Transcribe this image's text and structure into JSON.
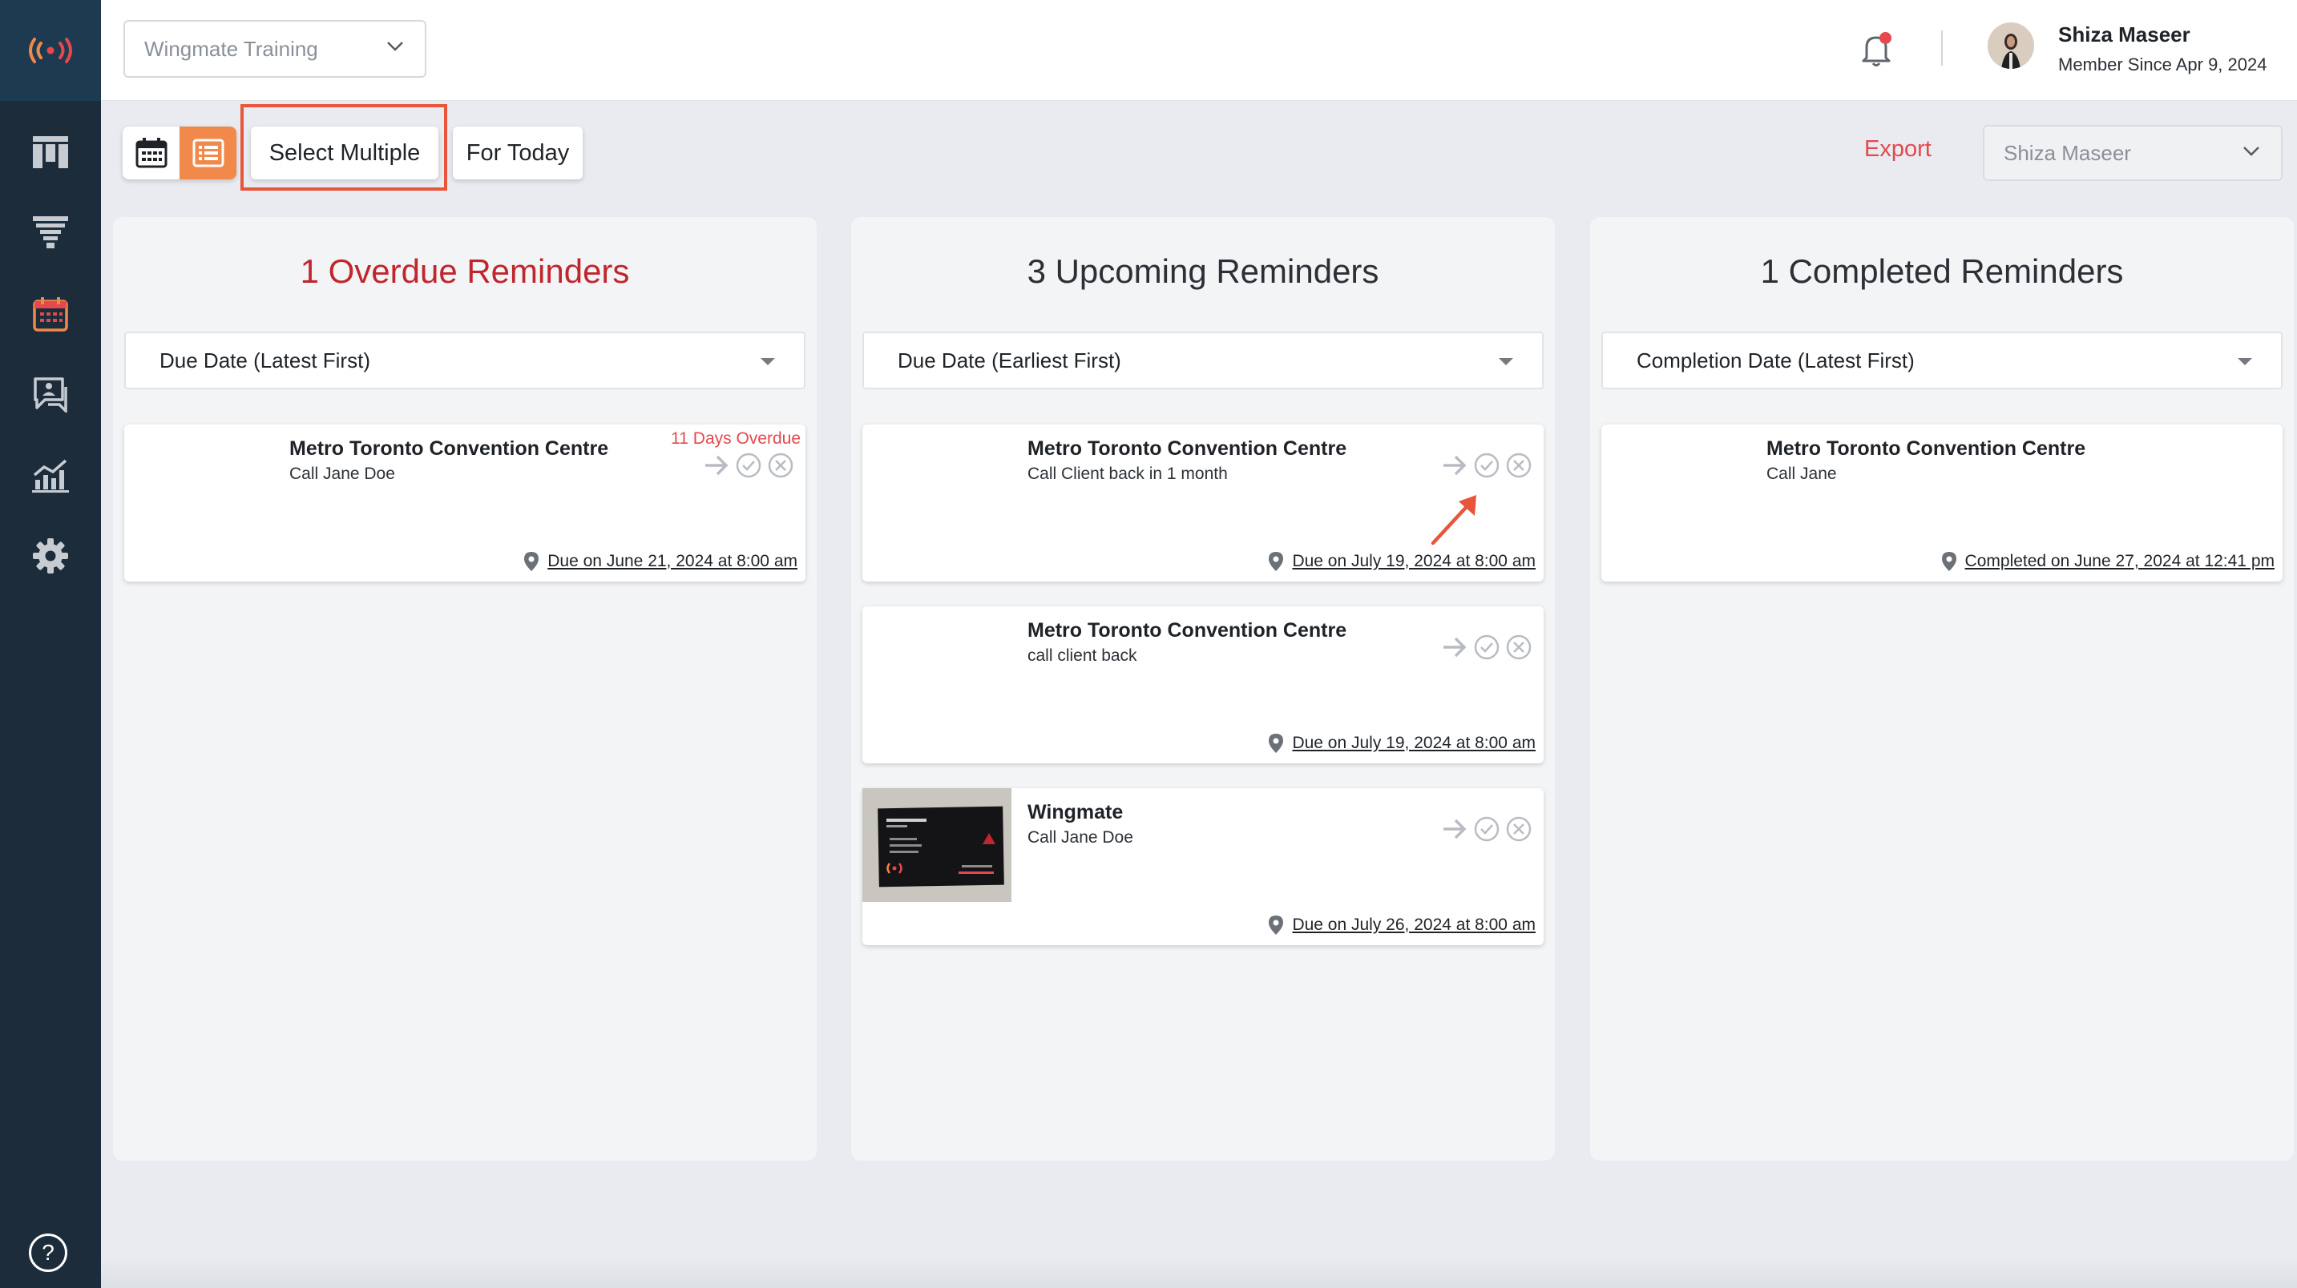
{
  "topbar": {
    "workspace": "Wingmate Training",
    "user_name": "Shiza Maseer",
    "member_since": "Member Since Apr 9, 2024"
  },
  "toolbar": {
    "select_multiple": "Select Multiple",
    "for_today": "For Today",
    "export": "Export",
    "user_filter": "Shiza Maseer"
  },
  "sidebar": {
    "items": [
      "logo-icon",
      "board-icon",
      "funnel-icon",
      "calendar-icon",
      "chat-icon",
      "analytics-icon",
      "settings-icon"
    ],
    "active": "calendar-icon",
    "help": "?"
  },
  "columns": {
    "overdue": {
      "title": "1 Overdue Reminders",
      "sort": "Due Date (Latest First)",
      "cards": [
        {
          "title": "Metro Toronto Convention Centre",
          "subtitle": "Call Jane Doe",
          "tag": "11 Days Overdue",
          "due": "Due on June 21, 2024 at 8:00 am"
        }
      ]
    },
    "upcoming": {
      "title": "3 Upcoming Reminders",
      "sort": "Due Date (Earliest First)",
      "cards": [
        {
          "title": "Metro Toronto Convention Centre",
          "subtitle": "Call Client back in 1 month",
          "due": "Due on July 19, 2024 at 8:00 am"
        },
        {
          "title": "Metro Toronto Convention Centre",
          "subtitle": "call client back",
          "due": "Due on July 19, 2024 at 8:00 am"
        },
        {
          "title": "Wingmate",
          "subtitle": "Call Jane Doe",
          "due": "Due on July 26, 2024 at 8:00 am"
        }
      ]
    },
    "completed": {
      "title": "1 Completed Reminders",
      "sort": "Completion Date (Latest First)",
      "cards": [
        {
          "title": "Metro Toronto Convention Centre",
          "subtitle": "Call Jane",
          "due": "Completed on June 27, 2024 at 12:41 pm"
        }
      ]
    }
  },
  "colors": {
    "accent": "#f0894a",
    "overdue": "#c0262d",
    "export": "#e5484d",
    "annotation": "#e8553a",
    "sidebar": "#1c2c3b"
  }
}
